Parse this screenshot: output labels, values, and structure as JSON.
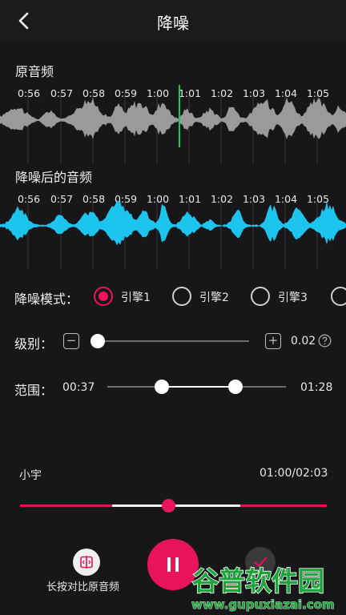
{
  "header": {
    "title": "降噪",
    "back_icon": "chevron-left-icon"
  },
  "original": {
    "label": "原音频",
    "ticks": [
      "0:56",
      "0:57",
      "0:58",
      "0:59",
      "1:00",
      "1:01",
      "1:02",
      "1:03",
      "1:04",
      "1:05"
    ],
    "color": "#9a9a9a",
    "playhead_color": "#1ec85a"
  },
  "processed": {
    "label": "降噪后的音频",
    "ticks": [
      "0:56",
      "0:57",
      "0:58",
      "0:59",
      "1:00",
      "1:01",
      "1:02",
      "1:03",
      "1:04",
      "1:05"
    ],
    "color": "#1cc4ee"
  },
  "mode": {
    "label": "降噪模式：",
    "options": [
      "引擎1",
      "引擎2",
      "引擎3"
    ],
    "selected_index": 0
  },
  "level": {
    "label": "级别：",
    "minus": "−",
    "plus": "+",
    "value": "0.02",
    "help_icon": "question-circle-icon",
    "fraction": 0.02
  },
  "range": {
    "label": "范围：",
    "start": "00:37",
    "end": "01:28"
  },
  "player": {
    "name": "小宇",
    "time": "01:00/02:03",
    "progress_fraction": 0.488
  },
  "actions": {
    "compare_label": "长按对比原音频",
    "compare_icon": "compare-icon",
    "pause_icon": "pause-icon",
    "confirm_icon": "check-icon"
  },
  "accent": "#e8155c",
  "watermark": {
    "brand": "谷普软件园",
    "url": "www.gupuxiazai.com"
  }
}
